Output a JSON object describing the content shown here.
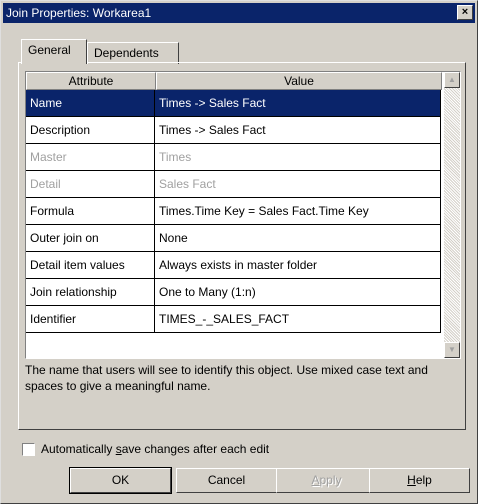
{
  "window": {
    "title": "Join Properties: Workarea1",
    "close_label": "×"
  },
  "tabs": [
    {
      "label": "General",
      "active": true
    },
    {
      "label": "Dependents",
      "active": false
    }
  ],
  "grid": {
    "columns": [
      "Attribute",
      "Value"
    ],
    "rows": [
      {
        "attribute": "Name",
        "value": "Times -> Sales Fact",
        "state": "selected"
      },
      {
        "attribute": "Description",
        "value": "Times -> Sales Fact",
        "state": "normal"
      },
      {
        "attribute": "Master",
        "value": "Times",
        "state": "disabled"
      },
      {
        "attribute": "Detail",
        "value": "Sales Fact",
        "state": "disabled"
      },
      {
        "attribute": "Formula",
        "value": "Times.Time Key = Sales Fact.Time Key",
        "state": "normal"
      },
      {
        "attribute": "Outer join on",
        "value": "None",
        "state": "normal"
      },
      {
        "attribute": "Detail item values",
        "value": "Always exists in master folder",
        "state": "normal"
      },
      {
        "attribute": "Join relationship",
        "value": "One to Many (1:n)",
        "state": "normal"
      },
      {
        "attribute": "Identifier",
        "value": "TIMES_-_SALES_FACT",
        "state": "normal"
      }
    ],
    "scroll_up_icon": "triangle-up",
    "scroll_down_icon": "triangle-down"
  },
  "description": "The name that users will see to identify this object. Use mixed case text and spaces to give a meaningful name.",
  "autosave": {
    "checked": false,
    "label_prefix": "Automatically ",
    "label_mnemonic": "s",
    "label_suffix": "ave changes after each edit"
  },
  "buttons": {
    "ok": "OK",
    "cancel": "Cancel",
    "apply_mnemonic": "A",
    "apply_rest": "pply",
    "help_mnemonic": "H",
    "help_rest": "elp"
  },
  "colors": {
    "titlebar": "#0a246a",
    "selection": "#0a246a",
    "face": "#d4d0c8"
  }
}
